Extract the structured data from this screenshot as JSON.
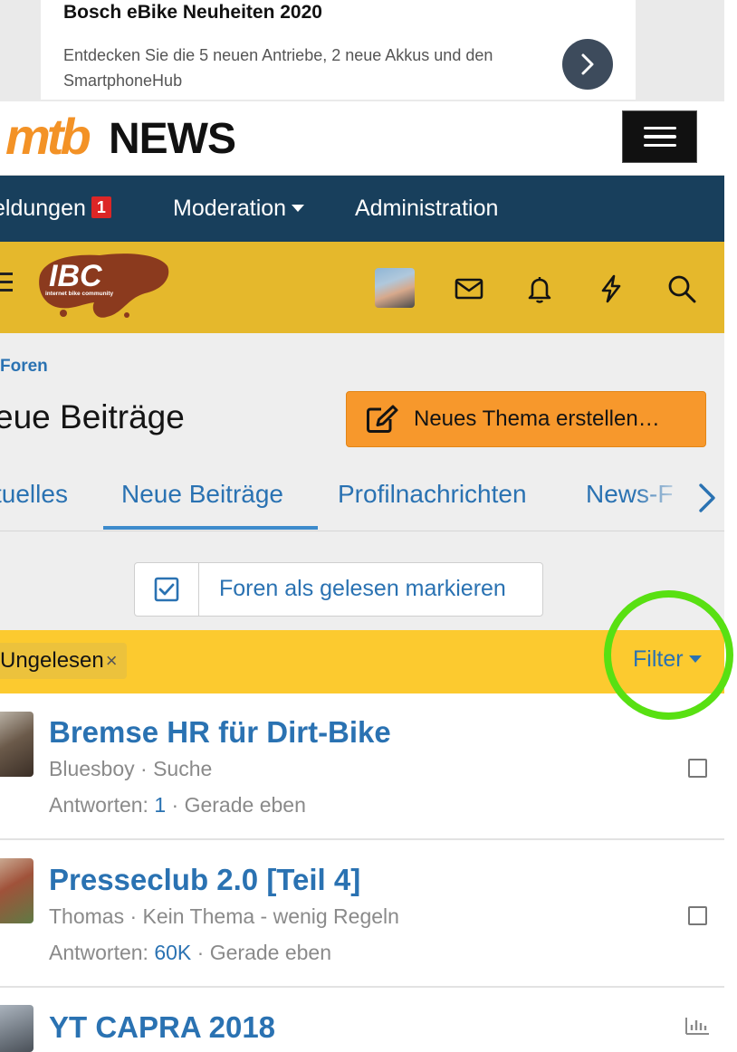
{
  "ad": {
    "title": "Bosch eBike Neuheiten 2020",
    "text": "Entdecken Sie die 5 neuen Antriebe, 2 neue Akkus und den SmartphoneHub"
  },
  "header": {
    "logo_mtb": "mtb",
    "logo_news": "NEWS"
  },
  "nav": {
    "items": [
      {
        "label": "eldungen",
        "badge": "1"
      },
      {
        "label": "Moderation"
      },
      {
        "label": "Administration"
      }
    ]
  },
  "ibc": {
    "logo_text": "IBC",
    "logo_subtext": "internet bike community"
  },
  "page": {
    "breadcrumb": "Foren",
    "title": "eue Beiträge",
    "new_thread_label": "Neues Thema erstellen…"
  },
  "tabs": [
    {
      "label": "tuelles"
    },
    {
      "label": "Neue Beiträge",
      "active": true
    },
    {
      "label": "Profilnachrichten"
    },
    {
      "label": "News-F"
    }
  ],
  "mark_read_label": "Foren als gelesen markieren",
  "filter": {
    "chip_label": "Ungelesen",
    "chip_remove": "×",
    "button_label": "Filter"
  },
  "threads": [
    {
      "title": "Bremse HR für Dirt-Bike",
      "author": "Bluesboy",
      "forum": "Suche",
      "replies_label": "Antworten:",
      "replies": "1",
      "time": "Gerade eben",
      "avatar_color": "#6b5a4a"
    },
    {
      "title": "Presseclub 2.0 [Teil 4]",
      "author": "Thomas",
      "forum": "Kein Thema - wenig Regeln",
      "replies_label": "Antworten:",
      "replies": "60K",
      "time": "Gerade eben",
      "avatar_color": "#7a9a5a"
    },
    {
      "title": "YT CAPRA 2018",
      "avatar_color": "#8a8f96"
    }
  ],
  "colors": {
    "nav_dark": "#183f5c",
    "ibc_bar": "#e5b82c",
    "filter_bar": "#fcca2f",
    "accent_orange": "#f7982c",
    "link_blue": "#2a72b2",
    "highlight_ring": "#58e012"
  }
}
